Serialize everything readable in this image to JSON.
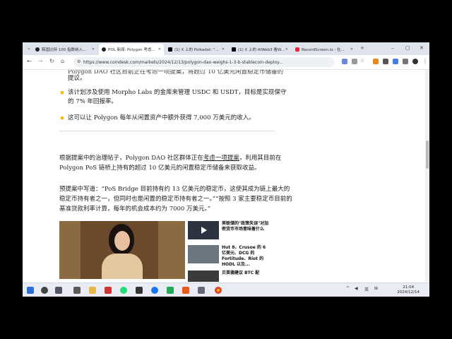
{
  "browser": {
    "tabs": [
      {
        "label": "韩国比特 100 指数纳入...",
        "active": false
      },
      {
        "label": "POL 新闻: Polygon 考虑...",
        "active": true
      },
      {
        "label": "(1) X 上的 Polkadot: \"...",
        "active": false
      },
      {
        "label": "(1) X 上的 AIWeb3 看W...",
        "active": false
      },
      {
        "label": "RecordScreen.io - 在...",
        "active": false
      }
    ],
    "url": "https://www.coindesk.com/markets/2024/12/13/polygon-dao-weighs-1-3-b-stablecoin-deploy..."
  },
  "article": {
    "top_fragment": "Polygon DAO 社区目前正在考虑一项提案，将超过 10 亿美元闲置稳定币储备的",
    "bullets": [
      "提议。",
      "该计划涉及使用 Morpho Labs 的金库来管理 USDC 和 USDT，目标是实现保守的 7% 年回报率。",
      "这可以让 Polygon 每年从闲置资产中额外获得 7,000 万美元的收入。"
    ],
    "para1_a": "根据提案中的治理帖子，Polygon DAO 社区群体正在",
    "para1_link": "考虑一项提案",
    "para1_b": "，利用其目前在 Polygon PoS 链桥上持有的超过 10 亿美元的闲置稳定币储备来获取收益。",
    "para2": "预提案中写道：“PoS Bridge 目前持有约 13 亿美元的稳定币，这使其成为链上最大的稳定币持有者之一，但同时也是闲置的稳定币持有者之一。”“按照 3 家主要稳定币目前的基准贷款利率计算，每年的机会成本约为 7000 万美元。”",
    "related": [
      "美联储的\"政策失误\"对加密货币市场意味着什么",
      "Hut 8、Crusoe 的 6 亿美元、DCG 的 Fortitude、Riot 的 HODL 以及...",
      "贝莱德建议 BTC 配"
    ]
  },
  "taskbar": {
    "tray_lang": "英",
    "time": "21:04",
    "date": "2024/12/14"
  }
}
